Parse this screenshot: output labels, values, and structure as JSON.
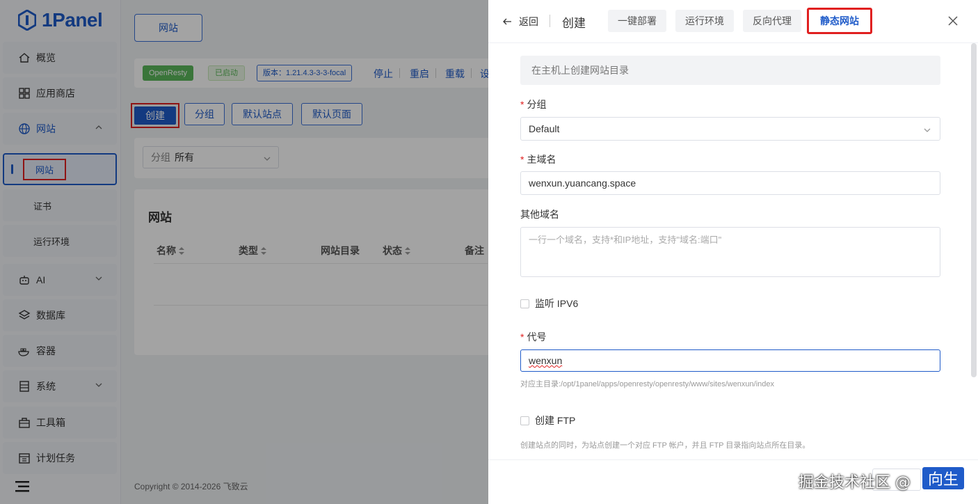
{
  "app": {
    "logo_text": "1Panel"
  },
  "sidebar": {
    "items": [
      {
        "label": "概览",
        "icon": "home-icon"
      },
      {
        "label": "应用商店",
        "icon": "grid-icon"
      },
      {
        "label": "网站",
        "icon": "globe-icon",
        "expanded": true
      },
      {
        "label": "网站",
        "icon": "",
        "active": true
      },
      {
        "label": "证书",
        "icon": ""
      },
      {
        "label": "运行环境",
        "icon": ""
      },
      {
        "label": "AI",
        "icon": "robot-icon"
      },
      {
        "label": "数据库",
        "icon": "layers-icon"
      },
      {
        "label": "容器",
        "icon": "docker-icon"
      },
      {
        "label": "系统",
        "icon": "server-icon"
      },
      {
        "label": "工具箱",
        "icon": "toolbox-icon"
      },
      {
        "label": "计划任务",
        "icon": "calendar-icon"
      }
    ]
  },
  "main": {
    "tab": "网站",
    "openresty_tag": "OpenResty",
    "status_tag": "已启动",
    "version_tag": "版本：1.21.4.3-3-3-focal",
    "actions": [
      "停止",
      "重启",
      "重载",
      "设"
    ],
    "buttons": {
      "create": "创建",
      "group": "分组",
      "default_site": "默认站点",
      "default_page": "默认页面"
    },
    "filter": {
      "label": "分组",
      "value": "所有"
    },
    "table": {
      "title": "网站",
      "columns": [
        "名称",
        "类型",
        "网站目录",
        "状态",
        "备注"
      ]
    },
    "footer": "Copyright © 2014-2026 飞致云"
  },
  "drawer": {
    "back": "返回",
    "title": "创建",
    "tabs": [
      "一键部署",
      "运行环境",
      "反向代理",
      "静态网站"
    ],
    "active_tab": "静态网站",
    "notice": "在主机上创建网站目录",
    "group_label": "分组",
    "group_value": "Default",
    "domain_label": "主域名",
    "domain_value": "wenxun.yuancang.space",
    "other_domains_label": "其他域名",
    "other_domains_placeholder": "一行一个域名，支持*和IP地址，支持\"域名:端口\"",
    "ipv6_label": "监听 IPV6",
    "alias_label": "代号",
    "alias_value": "wenxun",
    "alias_hint": "对应主目录:/opt/1panel/apps/openresty/openresty/www/sites/wenxun/index",
    "ftp_label": "创建 FTP",
    "ftp_hint": "创建站点的同时，为站点创建一个对应 FTP 帐户，并且 FTP 目录指向站点所在目录。"
  },
  "watermark": {
    "text": "掘金技术社区 @",
    "badge": "向生"
  },
  "colors": {
    "accent": "#1f5bc9",
    "highlight": "#e02020",
    "success": "#5cb85c"
  }
}
